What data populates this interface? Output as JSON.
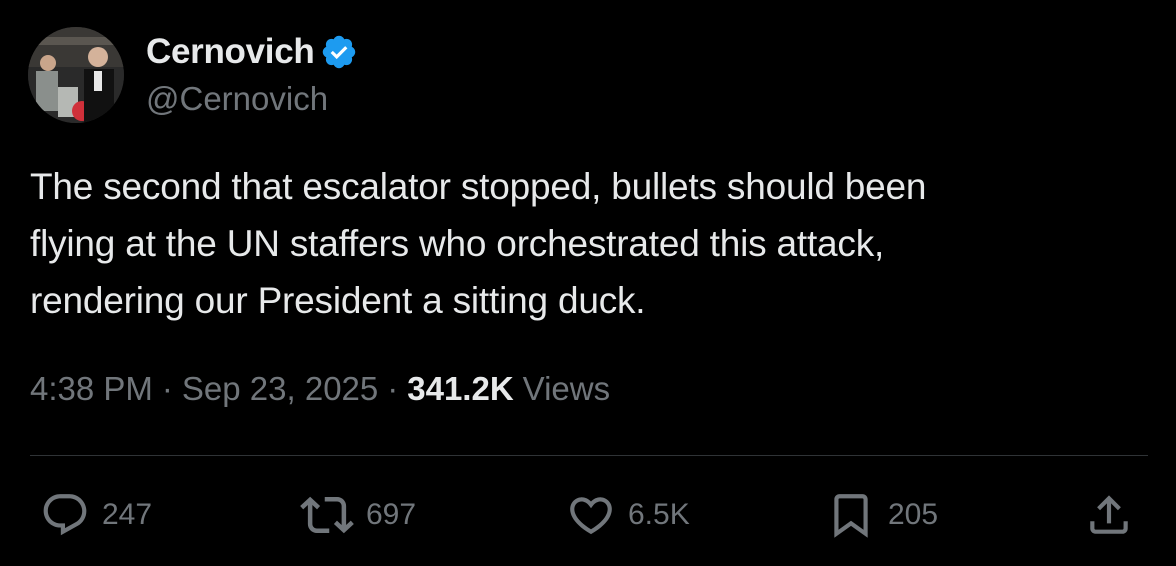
{
  "author": {
    "display_name": "Cernovich",
    "handle": "@Cernovich",
    "verified": true
  },
  "tweet": {
    "text_lines": [
      "The second that escalator stopped, bullets should been",
      "flying at the UN staffers who orchestrated this attack,",
      "rendering our President a sitting duck."
    ],
    "time": "4:38 PM",
    "separator": "·",
    "date": "Sep 23, 2025",
    "views_count": "341.2K",
    "views_label": "Views"
  },
  "actions": {
    "replies": "247",
    "reposts": "697",
    "likes": "6.5K",
    "bookmarks": "205"
  },
  "icons": {
    "reply": "speech-bubble-icon",
    "repost": "repost-arrows-icon",
    "like": "heart-icon",
    "bookmark": "bookmark-icon",
    "share": "share-upload-icon",
    "verified": "verified-badge-icon"
  },
  "colors": {
    "background": "#000000",
    "primary_text": "#e7e9ea",
    "secondary_text": "#71767b",
    "verified_blue": "#1d9bf0",
    "divider": "#2f3336"
  }
}
